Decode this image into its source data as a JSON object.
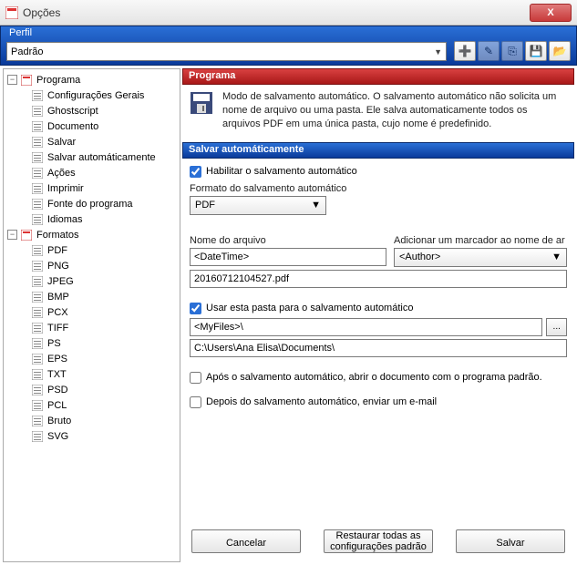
{
  "window": {
    "title": "Opções",
    "close": "X"
  },
  "perfil": {
    "label": "Perfil",
    "selected": "Padrão",
    "btns": {
      "add": "➕",
      "rename": "✎",
      "copy": "⎘",
      "save": "💾",
      "folder": "📂"
    }
  },
  "tree": {
    "programa": "Programa",
    "items1": [
      "Configurações Gerais",
      "Ghostscript",
      "Documento",
      "Salvar",
      "Salvar automáticamente",
      "Ações",
      "Imprimir",
      "Fonte do programa",
      "Idiomas"
    ],
    "formatos": "Formatos",
    "items2": [
      "PDF",
      "PNG",
      "JPEG",
      "BMP",
      "PCX",
      "TIFF",
      "PS",
      "EPS",
      "TXT",
      "PSD",
      "PCL",
      "Bruto",
      "SVG"
    ]
  },
  "content": {
    "section1": "Programa",
    "desc": "Modo de salvamento automático. O salvamento automático não solicita um nome de arquivo ou uma pasta. Ele salva automaticamente todos os arquivos PDF em uma única pasta, cujo nome é predefinido.",
    "section2": "Salvar automáticamente",
    "enable": "Habilitar o salvamento automático",
    "fmt_label": "Formato do salvamento automático",
    "fmt_value": "PDF",
    "name_label": "Nome do arquivo",
    "name_value": "<DateTime>",
    "marker_label": "Adicionar um marcador ao nome de ar",
    "marker_value": "<Author>",
    "preview": "20160712104527.pdf",
    "usefolder": "Usar esta pasta para o salvamento automático",
    "folder_value": "<MyFiles>\\",
    "folder_resolved": "C:\\Users\\Ana Elisa\\Documents\\",
    "openafter": "Após o salvamento automático, abrir o documento com o programa padrão.",
    "emailafter": "Depois do salvamento automático, enviar um e-mail"
  },
  "buttons": {
    "cancel": "Cancelar",
    "reset": "Restaurar todas as configurações padrão",
    "save": "Salvar"
  }
}
